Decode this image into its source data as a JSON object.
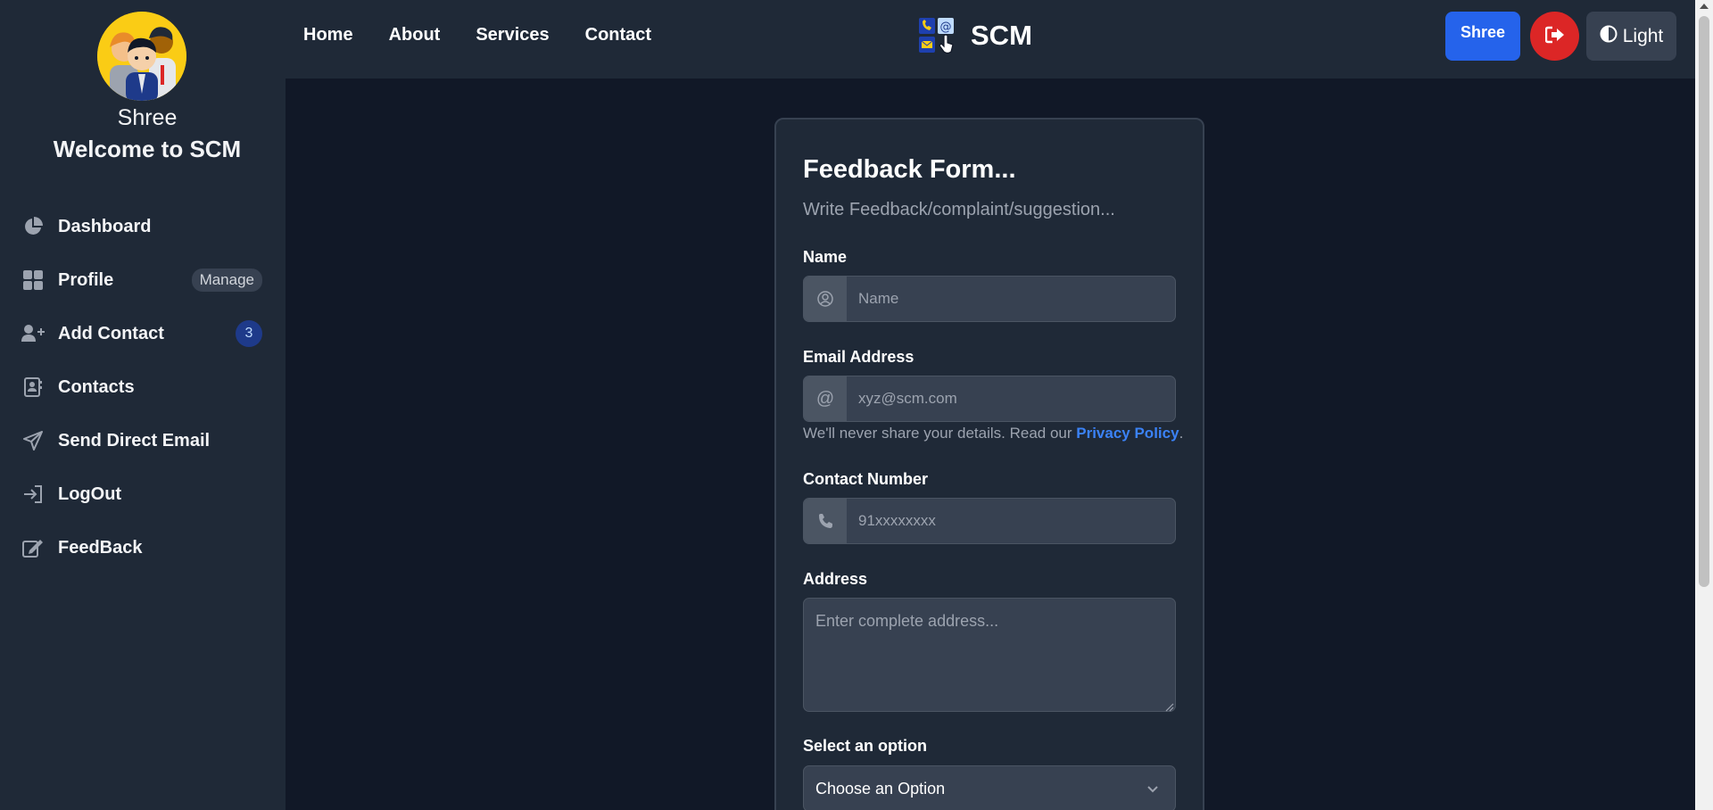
{
  "sidebar": {
    "user_name": "Shree",
    "welcome": "Welcome to SCM",
    "items": [
      {
        "label": "Dashboard",
        "icon": "pie-chart-icon"
      },
      {
        "label": "Profile",
        "icon": "grid-icon",
        "pill": "Manage"
      },
      {
        "label": "Add Contact",
        "icon": "user-plus-icon",
        "count": "3"
      },
      {
        "label": "Contacts",
        "icon": "address-book-icon"
      },
      {
        "label": "Send Direct Email",
        "icon": "paper-plane-icon"
      },
      {
        "label": "LogOut",
        "icon": "sign-in-icon"
      },
      {
        "label": "FeedBack",
        "icon": "edit-icon"
      }
    ]
  },
  "topbar": {
    "nav": [
      "Home",
      "About",
      "Services",
      "Contact"
    ],
    "brand": "SCM",
    "user_button": "Shree",
    "theme_button": "Light"
  },
  "form": {
    "title": "Feedback Form...",
    "subtitle": "Write Feedback/complaint/suggestion...",
    "name_label": "Name",
    "name_placeholder": "Name",
    "email_label": "Email Address",
    "email_placeholder": "xyz@scm.com",
    "help_prefix": "We'll never share your details. Read our ",
    "help_link": "Privacy Policy",
    "help_suffix": ".",
    "phone_label": "Contact Number",
    "phone_placeholder": "91xxxxxxxx",
    "address_label": "Address",
    "address_placeholder": "Enter complete address...",
    "select_label": "Select an option",
    "select_value": "Choose an Option"
  },
  "colors": {
    "background": "#111827",
    "panel": "#1f2937",
    "primary": "#2563eb",
    "danger": "#dc2626",
    "link": "#3b82f6"
  }
}
